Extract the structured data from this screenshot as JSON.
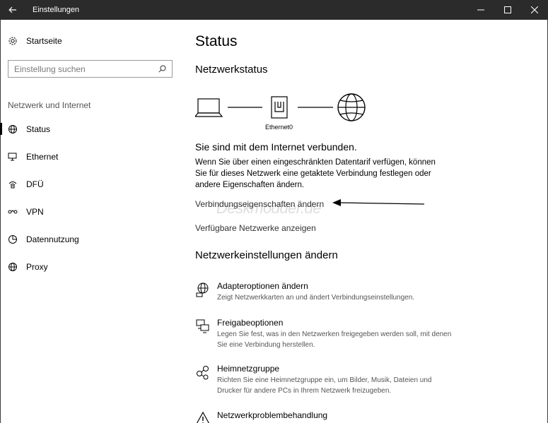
{
  "window": {
    "title": "Einstellungen"
  },
  "sidebar": {
    "home_label": "Startseite",
    "search_placeholder": "Einstellung suchen",
    "section_label": "Netzwerk und Internet",
    "items": [
      {
        "label": "Status",
        "icon": "globe-status-icon",
        "active": true
      },
      {
        "label": "Ethernet",
        "icon": "ethernet-icon"
      },
      {
        "label": "DFÜ",
        "icon": "dialup-icon"
      },
      {
        "label": "VPN",
        "icon": "vpn-icon"
      },
      {
        "label": "Datennutzung",
        "icon": "pie-chart-icon"
      },
      {
        "label": "Proxy",
        "icon": "globe-icon"
      }
    ]
  },
  "main": {
    "title": "Status",
    "network_status_heading": "Netzwerkstatus",
    "device_label": "Ethernet0",
    "connected_text": "Sie sind mit dem Internet verbunden.",
    "description": "Wenn Sie über einen eingeschränkten Datentarif verfügen, können Sie für dieses Netzwerk eine getaktete Verbindung festlegen oder andere Eigenschaften ändern.",
    "link_properties": "Verbindungseigenschaften ändern",
    "link_networks": "Verfügbare Netzwerke anzeigen",
    "watermark": "Deskmodder.de",
    "change_settings_heading": "Netzwerkeinstellungen ändern",
    "settings": [
      {
        "title": "Adapteroptionen ändern",
        "subtitle": "Zeigt Netzwerkkarten an und ändert Verbindungseinstellungen.",
        "icon": "adapter-icon"
      },
      {
        "title": "Freigabeoptionen",
        "subtitle": "Legen Sie fest, was in den Netzwerken freigegeben werden soll, mit denen Sie eine Verbindung herstellen.",
        "icon": "sharing-icon"
      },
      {
        "title": "Heimnetzgruppe",
        "subtitle": "Richten Sie eine Heimnetzgruppe ein, um Bilder, Musik, Dateien und Drucker für andere PCs in Ihrem Netzwerk freizugeben.",
        "icon": "homegroup-icon"
      },
      {
        "title": "Netzwerkproblembehandlung",
        "subtitle": "",
        "icon": "warning-icon"
      }
    ]
  }
}
